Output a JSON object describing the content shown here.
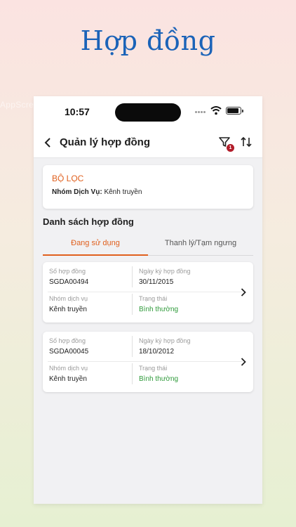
{
  "hero_title": "Hợp đồng",
  "watermark_text": "AppScreens",
  "status_bar": {
    "time": "10:57"
  },
  "nav": {
    "title": "Quản lý hợp đồng",
    "filter_badge": "1"
  },
  "filter": {
    "title": "BỘ LỌC",
    "label": "Nhóm Dịch Vụ:",
    "value": "Kênh truyền"
  },
  "list_title": "Danh sách hợp đồng",
  "tabs": [
    {
      "label": "Đang sử dụng",
      "active": true
    },
    {
      "label": "Thanh lý/Tạm ngưng",
      "active": false
    }
  ],
  "contracts": [
    {
      "contract_no_label": "Số hợp đồng",
      "contract_no": "SGDA00494",
      "sign_date_label": "Ngày ký hợp đồng",
      "sign_date": "30/11/2015",
      "service_group_label": "Nhóm dịch vụ",
      "service_group": "Kênh truyền",
      "status_label": "Trạng thái",
      "status": "Bình thường"
    },
    {
      "contract_no_label": "Số hợp đồng",
      "contract_no": "SGDA00045",
      "sign_date_label": "Ngày ký hợp đồng",
      "sign_date": "18/10/2012",
      "service_group_label": "Nhóm dịch vụ",
      "service_group": "Kênh truyền",
      "status_label": "Trạng thái",
      "status": "Bình thường"
    }
  ],
  "colors": {
    "accent": "#e0601e",
    "title_blue": "#1b63b8",
    "status_ok": "#2e9a3a",
    "badge": "#b21d2a"
  }
}
